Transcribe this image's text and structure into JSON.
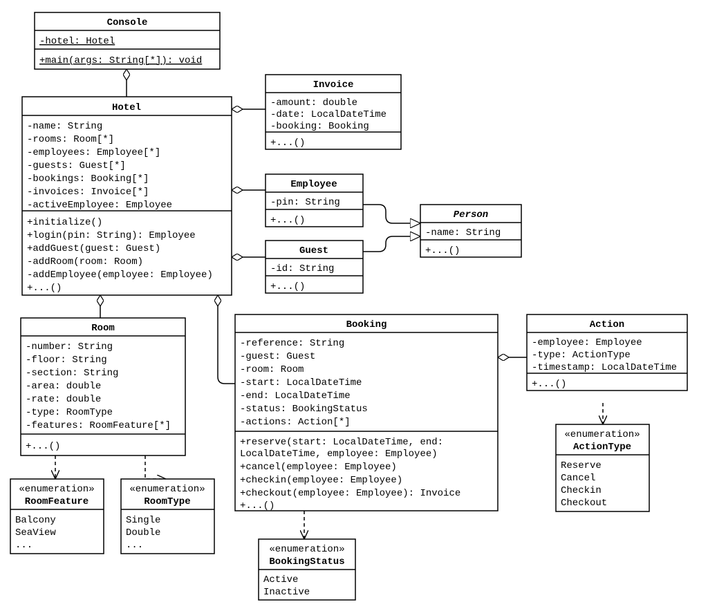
{
  "classes": {
    "Console": {
      "title": "Console",
      "attrs": [
        "-hotel: Hotel"
      ],
      "ops": [
        "+main(args: String[*]): void"
      ]
    },
    "Hotel": {
      "title": "Hotel",
      "attrs": [
        "-name: String",
        "-rooms: Room[*]",
        "-employees: Employee[*]",
        "-guests: Guest[*]",
        "-bookings: Booking[*]",
        "-invoices: Invoice[*]",
        "-activeEmployee: Employee"
      ],
      "ops": [
        "+initialize()",
        "+login(pin: String): Employee",
        "+addGuest(guest: Guest)",
        "-addRoom(room: Room)",
        "-addEmployee(employee: Employee)",
        "+...()"
      ]
    },
    "Invoice": {
      "title": "Invoice",
      "attrs": [
        "-amount: double",
        "-date: LocalDateTime",
        "-booking: Booking"
      ],
      "ops": [
        "+...()"
      ]
    },
    "Employee": {
      "title": "Employee",
      "attrs": [
        "-pin: String"
      ],
      "ops": [
        "+...()"
      ]
    },
    "Guest": {
      "title": "Guest",
      "attrs": [
        "-id: String"
      ],
      "ops": [
        "+...()"
      ]
    },
    "Person": {
      "title": "Person",
      "attrs": [
        "-name: String"
      ],
      "ops": [
        "+...()"
      ]
    },
    "Room": {
      "title": "Room",
      "attrs": [
        "-number: String",
        "-floor: String",
        "-section: String",
        "-area: double",
        "-rate: double",
        "-type: RoomType",
        "-features: RoomFeature[*]"
      ],
      "ops": [
        "+...()"
      ]
    },
    "Booking": {
      "title": "Booking",
      "attrs": [
        "-reference: String",
        "-guest: Guest",
        "-room: Room",
        "-start: LocalDateTime",
        "-end: LocalDateTime",
        "-status: BookingStatus",
        "-actions: Action[*]"
      ],
      "ops": [
        "+reserve(start: LocalDateTime, end:",
        "LocalDateTime, employee: Employee)",
        "+cancel(employee: Employee)",
        "+checkin(employee: Employee)",
        "+checkout(employee: Employee): Invoice",
        "+...()"
      ]
    },
    "Action": {
      "title": "Action",
      "attrs": [
        "-employee: Employee",
        "-type: ActionType",
        "-timestamp: LocalDateTime"
      ],
      "ops": [
        "+...()"
      ]
    },
    "RoomFeature": {
      "stereotype": "«enumeration»",
      "title": "RoomFeature",
      "values": [
        "Balcony",
        "SeaView",
        "..."
      ]
    },
    "RoomType": {
      "stereotype": "«enumeration»",
      "title": "RoomType",
      "values": [
        "Single",
        "Double",
        "..."
      ]
    },
    "BookingStatus": {
      "stereotype": "«enumeration»",
      "title": "BookingStatus",
      "values": [
        "Active",
        "Inactive"
      ]
    },
    "ActionType": {
      "stereotype": "«enumeration»",
      "title": "ActionType",
      "values": [
        "Reserve",
        "Cancel",
        "Checkin",
        "Checkout"
      ]
    }
  }
}
